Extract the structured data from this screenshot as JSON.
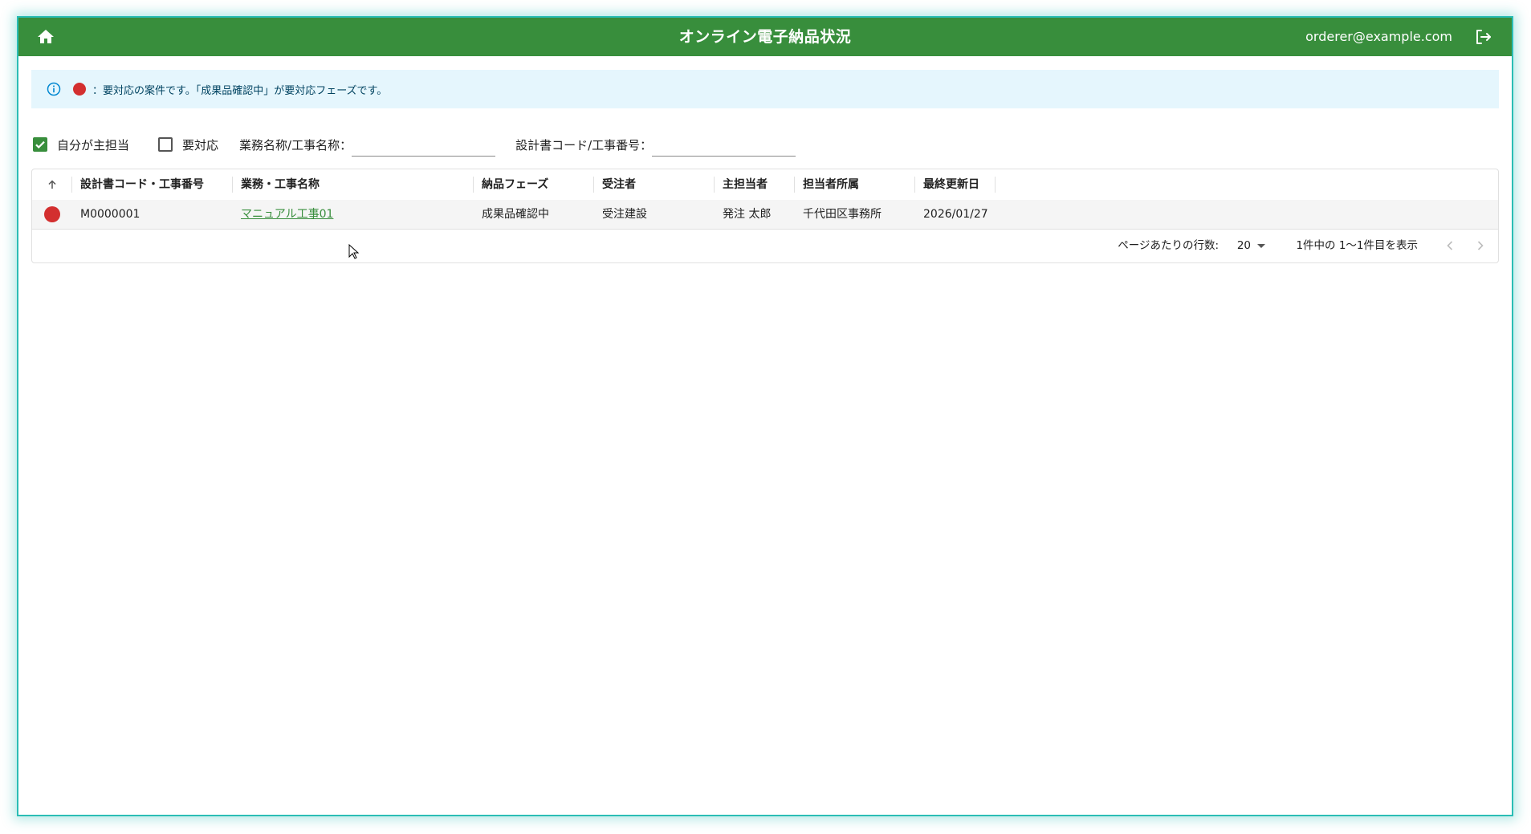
{
  "appbar": {
    "title": "オンライン電子納品状況",
    "user_email": "orderer@example.com",
    "color": "#388e3c"
  },
  "info": {
    "text": "：要対応の案件です。「成果品確認中」が要対応フェーズです。"
  },
  "filters": {
    "my_primary_label": "自分が主担当",
    "my_primary_checked": true,
    "needs_action_label": "要対応",
    "needs_action_checked": false,
    "project_name_label": "業務名称/工事名称：",
    "project_name_value": "",
    "code_label": "設計書コード/工事番号：",
    "code_value": ""
  },
  "table": {
    "columns": [
      "設計書コード・工事番号",
      "業務・工事名称",
      "納品フェーズ",
      "受注者",
      "主担当者",
      "担当者所属",
      "最終更新日"
    ],
    "rows": [
      {
        "needs_action": true,
        "code": "M0000001",
        "name": "マニュアル工事01",
        "phase": "成果品確認中",
        "contractor": "受注建設",
        "owner": "発注 太郎",
        "department": "千代田区事務所",
        "updated": "2026/01/27"
      }
    ]
  },
  "pagination": {
    "rows_per_page_label": "ページあたりの行数:",
    "rows_per_page": "20",
    "range_text": "1件中の 1〜1件目を表示"
  }
}
